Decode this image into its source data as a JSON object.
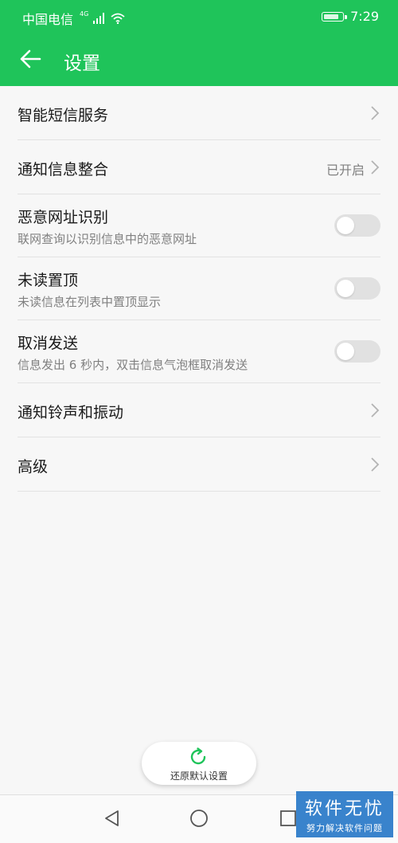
{
  "status_bar": {
    "carrier": "中国电信",
    "network": "4G",
    "time": "7:29",
    "battery_level": 0.85,
    "icons": [
      "signal-icon",
      "wifi-icon",
      "battery-icon"
    ]
  },
  "header": {
    "title": "设置",
    "back_icon": "arrow-left-icon",
    "background_color": "#1fc45a"
  },
  "settings": {
    "smart_sms": {
      "title": "智能短信服务"
    },
    "notify_merge": {
      "title": "通知信息整合",
      "value": "已开启"
    },
    "malicious_url": {
      "title": "恶意网址识别",
      "subtitle": "联网查询以识别信息中的恶意网址",
      "enabled": false
    },
    "pin_unread": {
      "title": "未读置顶",
      "subtitle": "未读信息在列表中置顶显示",
      "enabled": false
    },
    "cancel_send": {
      "title": "取消发送",
      "subtitle": "信息发出 6 秒内，双击信息气泡框取消发送",
      "enabled": false
    },
    "ringtone": {
      "title": "通知铃声和振动"
    },
    "advanced": {
      "title": "高级"
    }
  },
  "restore": {
    "label": "还原默认设置",
    "icon": "refresh-icon",
    "accent_color": "#1fc45a"
  },
  "navbar": {
    "icons": [
      "back-triangle-icon",
      "home-circle-icon",
      "recents-square-icon"
    ]
  },
  "watermark": {
    "title": "软件无忧",
    "subtitle": "努力解决软件问题"
  }
}
